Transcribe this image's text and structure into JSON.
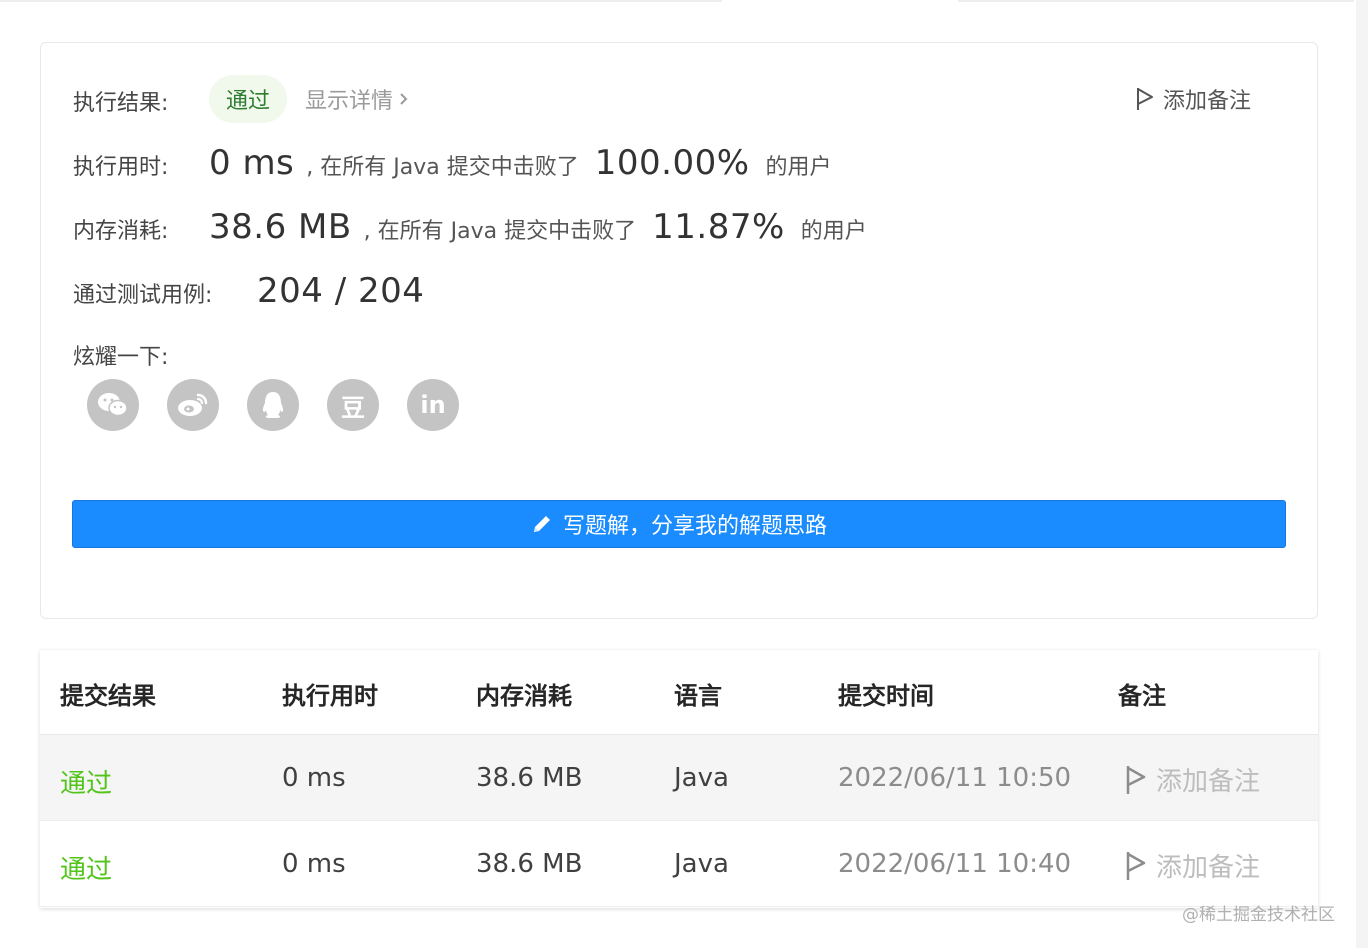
{
  "result": {
    "exec_result_label": "执行结果:",
    "status": "通过",
    "show_details": "显示详情",
    "add_note": "添加备注",
    "runtime_label": "执行用时:",
    "runtime_value": "0 ms",
    "runtime_text": ", 在所有 Java 提交中击败了",
    "runtime_percent": "100.00%",
    "runtime_suffix": "的用户",
    "memory_label": "内存消耗:",
    "memory_value": "38.6 MB",
    "memory_text": ", 在所有 Java 提交中击败了",
    "memory_percent": "11.87%",
    "memory_suffix": "的用户",
    "testcases_label": "通过测试用例:",
    "testcases_value": "204 / 204",
    "share_label": "炫耀一下:",
    "share_icons": [
      "wechat-icon",
      "weibo-icon",
      "qq-icon",
      "douban-icon",
      "linkedin-icon"
    ],
    "douban_glyph": "豆",
    "linkedin_glyph": "in",
    "write_solution": "写题解，分享我的解题思路"
  },
  "table": {
    "headers": [
      "提交结果",
      "执行用时",
      "内存消耗",
      "语言",
      "提交时间",
      "备注"
    ],
    "rows": [
      {
        "result": "通过",
        "runtime": "0 ms",
        "memory": "38.6 MB",
        "language": "Java",
        "time": "2022/06/11 10:50",
        "note": "添加备注"
      },
      {
        "result": "通过",
        "runtime": "0 ms",
        "memory": "38.6 MB",
        "language": "Java",
        "time": "2022/06/11 10:40",
        "note": "添加备注"
      }
    ]
  },
  "watermark": "@稀土掘金技术社区",
  "colors": {
    "accent": "#1a8cff",
    "success": "#52c41a",
    "pill_bg": "#f0f9eb",
    "icon_gray": "#c4c4c4"
  }
}
